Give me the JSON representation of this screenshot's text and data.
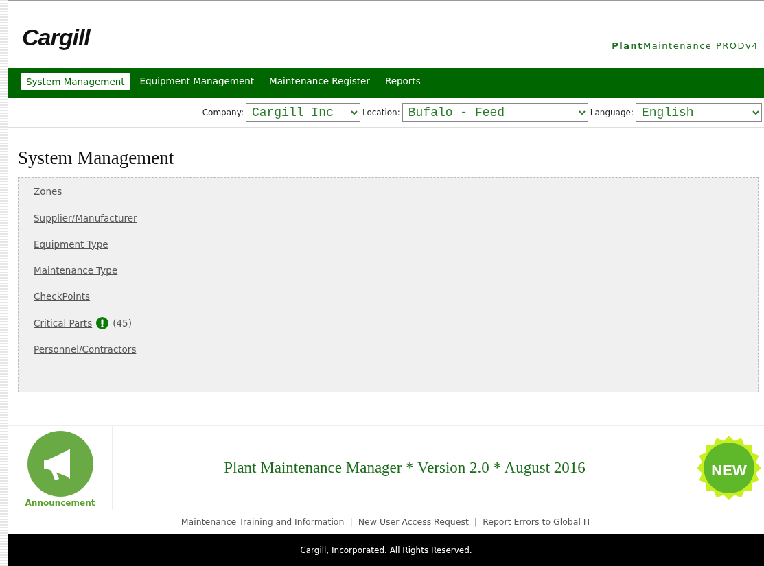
{
  "header": {
    "logo": "Cargill",
    "app_name": "**Plant**Maintenance PRODv4"
  },
  "nav_tabs": [
    {
      "label": "System Management",
      "selected": true
    },
    {
      "label": "Equipment Management",
      "selected": false
    },
    {
      "label": "Maintenance Register",
      "selected": false
    },
    {
      "label": "Reports",
      "selected": false
    }
  ],
  "filters": [
    {
      "label": "Company:",
      "value": "Cargill Inc",
      "kind": "short"
    },
    {
      "label": "Location:",
      "value": "Bufalo - Feed",
      "kind": "wide"
    },
    {
      "label": "Language:",
      "value": "English",
      "kind": "wide"
    }
  ],
  "page_title": "System Management",
  "menu_links": [
    {
      "label": "Zones"
    },
    {
      "label": "Supplier/Manufacturer"
    },
    {
      "label": "Equipment Type"
    },
    {
      "label": "Maintenance Type"
    },
    {
      "label": "CheckPoints"
    },
    {
      "label": "Critical Parts",
      "alert": true,
      "count": "(45)"
    },
    {
      "label": "Personnel/Contractors"
    }
  ],
  "announcement": {
    "label": "Announcement",
    "message": "Plant Maintenance Manager * Version 2.0 * August 2016",
    "badge": "NEW"
  },
  "footer_links": [
    "Maintenance Training and Information",
    "New User Access Request",
    "Report Errors to Global IT"
  ],
  "separator": "|",
  "copyright": "Cargill, Incorporated. All Rights Reserved."
}
